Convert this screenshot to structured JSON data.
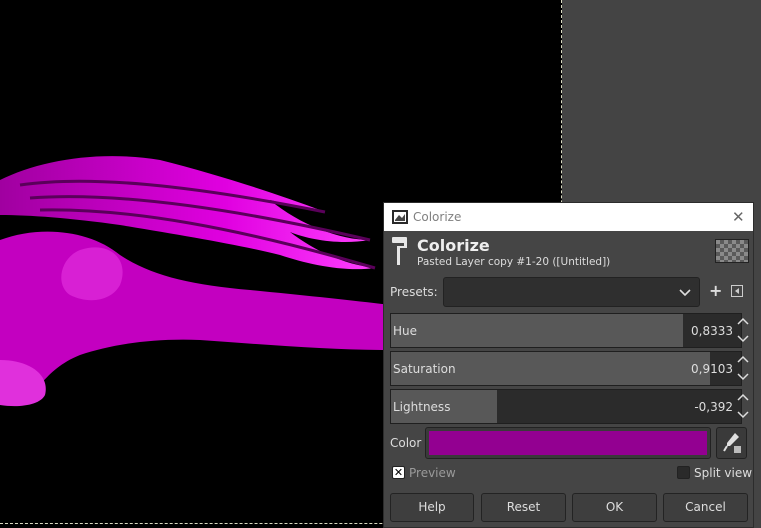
{
  "dialog": {
    "window_title": "Colorize",
    "header_title": "Colorize",
    "header_subtitle": "Pasted Layer copy #1-20 ([Untitled])",
    "presets_label": "Presets:",
    "presets_value": "",
    "sliders": [
      {
        "label": "Hue",
        "value": "0,8333",
        "fraction": 0.8333
      },
      {
        "label": "Saturation",
        "value": "0,9103",
        "fraction": 0.9103
      },
      {
        "label": "Lightness",
        "value": "-0,392",
        "fraction": 0.304
      }
    ],
    "color_label": "Color",
    "color_value": "#930091",
    "preview_label": "Preview",
    "preview_checked": true,
    "split_view_label": "Split view",
    "split_view_checked": false,
    "buttons": {
      "help": "Help",
      "reset": "Reset",
      "ok": "OK",
      "cancel": "Cancel"
    }
  },
  "colors": {
    "dragon": "#e600e0",
    "canvas": "#000000",
    "outside_canvas": "#444444"
  }
}
